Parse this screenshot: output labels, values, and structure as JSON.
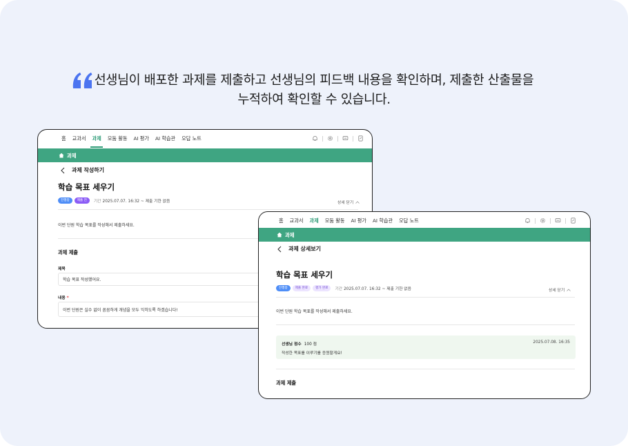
{
  "headline": {
    "line1": "선생님이 배포한 과제를 제출하고 선생님의 피드백 내용을 확인하며, 제출한 산출물을",
    "line2": "누적하여 확인할 수 있습니다."
  },
  "colors": {
    "accent": "#3fa582",
    "background": "#eef2fb",
    "quote": "#4b74f0"
  },
  "nav": {
    "items": [
      "홈",
      "교과서",
      "과제",
      "모둠 활동",
      "AI 평가",
      "AI 학습관",
      "오답 노트"
    ],
    "active": "과제",
    "icons": [
      "bell-icon",
      "gear-icon",
      "message-icon",
      "document-icon"
    ]
  },
  "screen1": {
    "band_title": "과제",
    "subheader": "과제 작성하기",
    "title": "학습 목표 세우기",
    "badges": [
      "진행중",
      "제출 전"
    ],
    "period_label": "기간",
    "period_value": "2025.07.07. 16:32 ~ 제출 기한 없음",
    "detail_toggle": "상세 닫기",
    "description": "이번 단원 학습 목표를 작성해서 제출하세요.",
    "section_title": "과제 제출",
    "field_title_label": "제목",
    "field_title_value": "학습 목표 작성했어요.",
    "field_content_label": "내용",
    "field_content_required": "*",
    "field_content_value": "이번 단원은 실수 없이 꼼꼼하게 개념을 모두 익히도록 하겠습니다!"
  },
  "screen2": {
    "band_title": "과제",
    "subheader": "과제 상세보기",
    "title": "학습 목표 세우기",
    "badges": [
      "진행중",
      "제출 완료",
      "평가 완료"
    ],
    "period_label": "기간",
    "period_value": "2025.07.07. 16:32 ~ 제출 기한 없음",
    "detail_toggle": "상세 닫기",
    "description": "이번 단원 학습 목표를 작성해서 제출하세요.",
    "feedback": {
      "score_label": "선생님 점수",
      "score_value": "100 점",
      "date": "2025.07.08. 16:35",
      "message": "작성한 목표를 이루기를 응원할게요!"
    },
    "section_title": "과제 제출"
  }
}
